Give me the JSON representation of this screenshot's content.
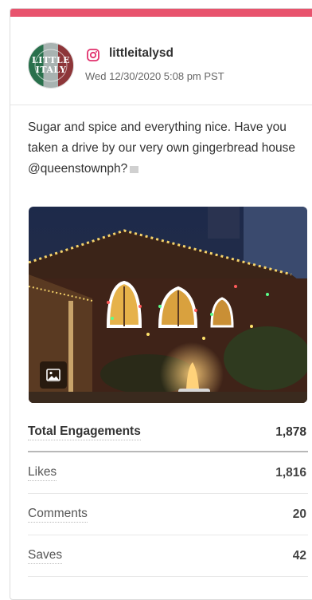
{
  "post": {
    "network_icon": "instagram-icon",
    "username": "littleitalysd",
    "timestamp": "Wed 12/30/2020 5:08 pm PST",
    "avatar_text_line1": "LITTLE",
    "avatar_text_line2": "ITALY",
    "caption": "Sugar and spice and everything nice. Have you taken a drive by our very own gingerbread house @queenstownph?",
    "media_type_icon": "image-icon"
  },
  "colors": {
    "accent_bar": "#e8536d",
    "instagram": "#e1306c"
  },
  "stats": [
    {
      "label": "Total Engagements",
      "value": "1,878"
    },
    {
      "label": "Likes",
      "value": "1,816"
    },
    {
      "label": "Comments",
      "value": "20"
    },
    {
      "label": "Saves",
      "value": "42"
    }
  ]
}
